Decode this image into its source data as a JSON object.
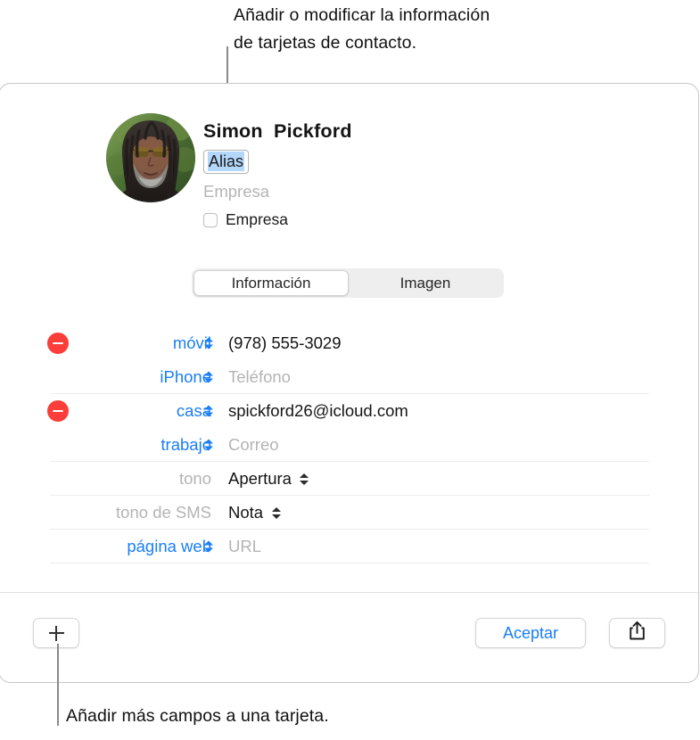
{
  "callouts": {
    "top": "Añadir o modificar la información\nde tarjetas de contacto.",
    "bottom": "Añadir más campos a una tarjeta."
  },
  "card": {
    "header": {
      "avatar_name": "contact-avatar-photo",
      "contact_name": "Simon  Pickford",
      "alias_value": "Alias",
      "company_placeholder": "Empresa",
      "company_checkbox_label": "Empresa",
      "company_checkbox_checked": false
    },
    "tabs": [
      {
        "label": "Información",
        "selected": true
      },
      {
        "label": "Imagen",
        "selected": false
      }
    ],
    "fields": [
      {
        "name": "mobile-phone",
        "has_remove": true,
        "label": "móvil",
        "label_style": "link",
        "has_label_stepper": true,
        "value": "(978) 555-3029",
        "value_is_placeholder": false,
        "value_has_stepper": false,
        "divider_below": false
      },
      {
        "name": "iphone-phone",
        "has_remove": false,
        "label": "iPhone",
        "label_style": "link",
        "has_label_stepper": true,
        "value": "Teléfono",
        "value_is_placeholder": true,
        "value_has_stepper": false,
        "divider_below": true
      },
      {
        "name": "home-email",
        "has_remove": true,
        "label": "casa",
        "label_style": "link",
        "has_label_stepper": true,
        "value": "spickford26@icloud.com",
        "value_is_placeholder": false,
        "value_has_stepper": false,
        "divider_below": false
      },
      {
        "name": "work-email",
        "has_remove": false,
        "label": "trabajo",
        "label_style": "link",
        "has_label_stepper": true,
        "value": "Correo",
        "value_is_placeholder": true,
        "value_has_stepper": false,
        "divider_below": true
      },
      {
        "name": "ringtone",
        "has_remove": false,
        "label": "tono",
        "label_style": "muted",
        "has_label_stepper": false,
        "value": "Apertura",
        "value_is_placeholder": false,
        "value_has_stepper": true,
        "divider_below": true
      },
      {
        "name": "sms-tone",
        "has_remove": false,
        "label": "tono de SMS",
        "label_style": "muted",
        "has_label_stepper": false,
        "value": "Nota",
        "value_is_placeholder": false,
        "value_has_stepper": true,
        "divider_below": true
      },
      {
        "name": "website",
        "has_remove": false,
        "label": "página web",
        "label_style": "link",
        "has_label_stepper": true,
        "value": "URL",
        "value_is_placeholder": true,
        "value_has_stepper": false,
        "divider_below": true
      }
    ],
    "toolbar": {
      "add_icon": "plus-icon",
      "accept_label": "Aceptar",
      "share_icon": "share-icon"
    }
  },
  "colors": {
    "accent_blue": "#1a7ef6",
    "remove_red": "#fc3d39",
    "selection_blue": "#b3d7fb",
    "placeholder_gray": "#b4b4b4",
    "card_border": "#c6c6c6",
    "divider": "#ededed"
  }
}
